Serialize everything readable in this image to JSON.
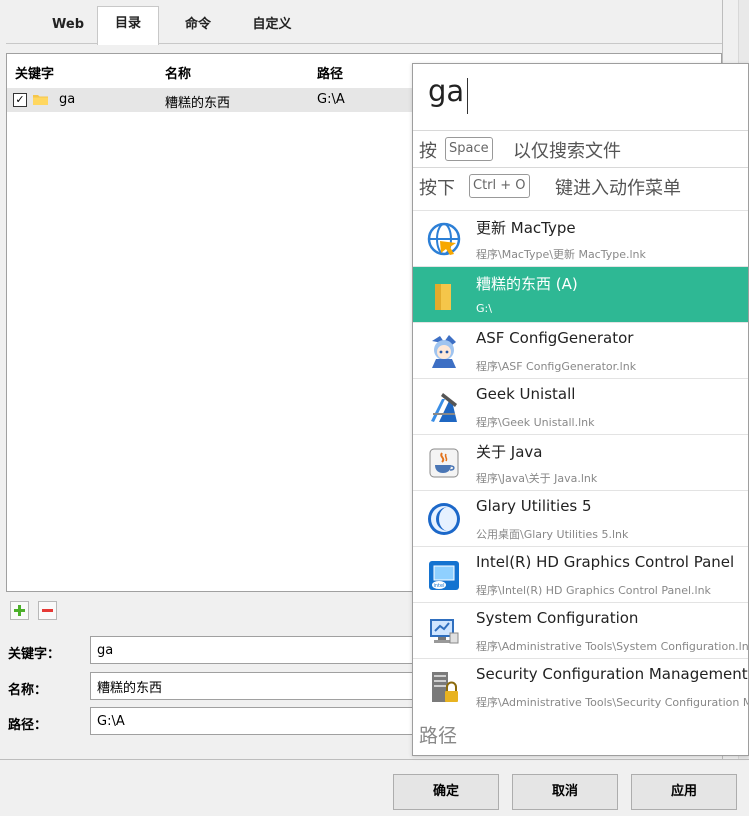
{
  "tabs": [
    {
      "label": "Web"
    },
    {
      "label": "目录"
    },
    {
      "label": "命令"
    },
    {
      "label": "自定义"
    }
  ],
  "list": {
    "columns": [
      "关键字",
      "名称",
      "路径"
    ],
    "rows": [
      {
        "checked": true,
        "keyword": "ga",
        "name": "糟糕的东西",
        "path": "G:\\A"
      }
    ]
  },
  "form": {
    "keyword_label": "关键字：",
    "keyword_value": "ga",
    "name_label": "名称：",
    "name_value": "糟糕的东西",
    "path_label": "路径：",
    "path_value": "G:\\A"
  },
  "buttons": {
    "ok": "确定",
    "cancel": "取消",
    "apply": "应用"
  },
  "launcher": {
    "query": "ga",
    "hint1": {
      "before": "按",
      "key": "Space",
      "after": "以仅搜索文件"
    },
    "hint2": {
      "before": "按下",
      "key": "Ctrl + O",
      "after": "键进入动作菜单"
    },
    "results": [
      {
        "title": "更新 MacType",
        "sub": "程序\\MacType\\更新 MacType.lnk",
        "icon": "mactype-globe-icon"
      },
      {
        "title": "糟糕的东西 (A)",
        "sub": "G:\\",
        "icon": "folder-icon"
      },
      {
        "title": "ASF ConfigGenerator",
        "sub": "程序\\ASF ConfigGenerator.lnk",
        "icon": "anime-character-icon"
      },
      {
        "title": "Geek Unistall",
        "sub": "程序\\Geek Unistall.lnk",
        "icon": "xcode-hammer-icon"
      },
      {
        "title": "关于 Java",
        "sub": "程序\\Java\\关于 Java.lnk",
        "icon": "java-cup-icon"
      },
      {
        "title": "Glary Utilities 5",
        "sub": "公用桌面\\Glary Utilities 5.lnk",
        "icon": "glary-moon-icon"
      },
      {
        "title": "Intel(R) HD Graphics Control Panel",
        "sub": "程序\\Intel(R) HD Graphics Control Panel.lnk",
        "icon": "intel-graphics-icon"
      },
      {
        "title": "System Configuration",
        "sub": "程序\\Administrative Tools\\System Configuration.lnk",
        "icon": "system-config-monitor-icon"
      },
      {
        "title": "Security Configuration Management",
        "sub": "程序\\Administrative Tools\\Security Configuration Management.lnk",
        "icon": "security-server-lock-icon"
      }
    ],
    "footer": "路径"
  },
  "colors": {
    "selected": "#2eb894",
    "folder": "#f5c64a"
  }
}
